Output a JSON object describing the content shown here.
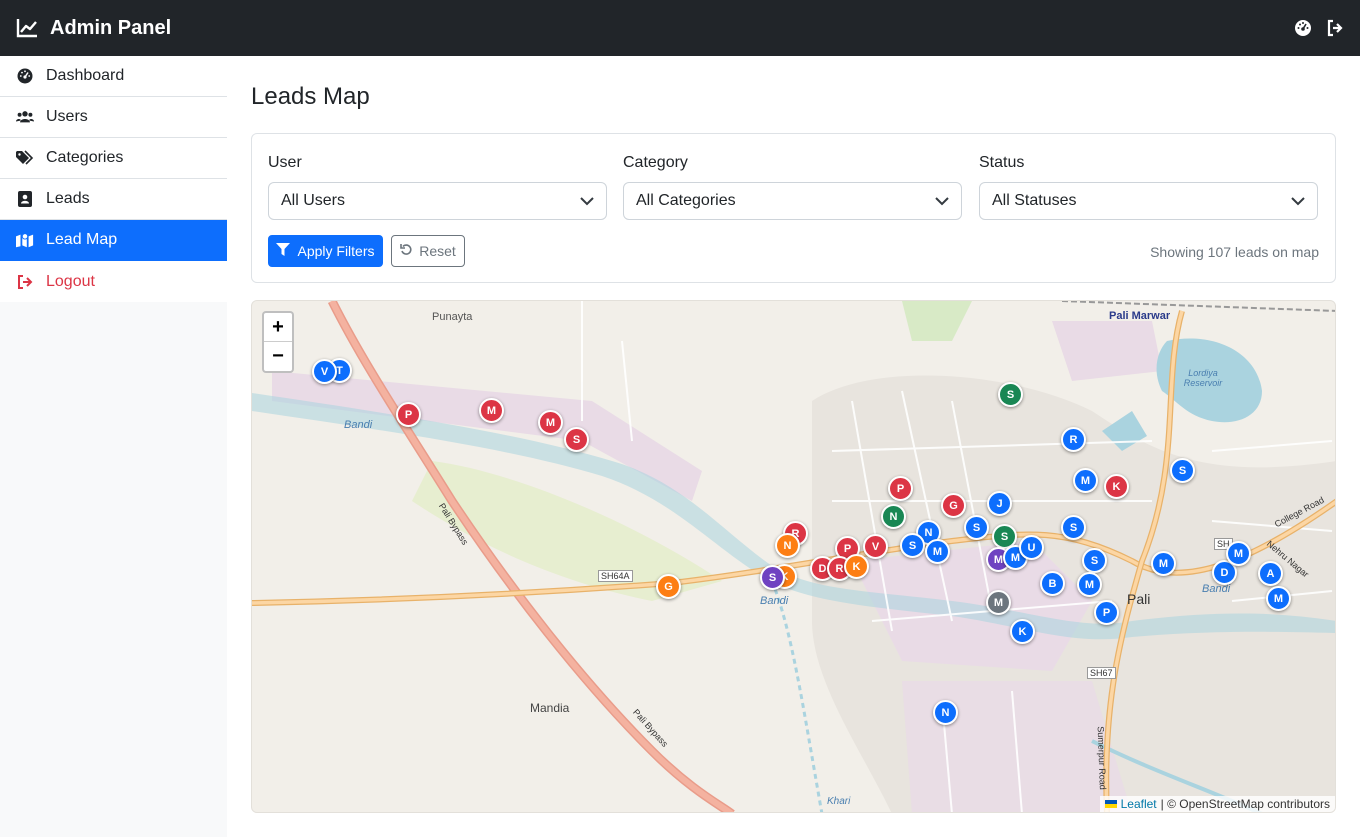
{
  "navbar": {
    "brand": "Admin Panel",
    "brand_icon": "chart-line-icon",
    "actions": [
      {
        "name": "dashboard-gauge-icon"
      },
      {
        "name": "logout-icon"
      }
    ]
  },
  "sidebar": {
    "items": [
      {
        "label": "Dashboard",
        "icon": "gauge-icon",
        "active": false
      },
      {
        "label": "Users",
        "icon": "users-icon",
        "active": false
      },
      {
        "label": "Categories",
        "icon": "tags-icon",
        "active": false
      },
      {
        "label": "Leads",
        "icon": "address-card-icon",
        "active": false
      },
      {
        "label": "Lead Map",
        "icon": "map-icon",
        "active": true
      },
      {
        "label": "Logout",
        "icon": "logout-icon",
        "active": false
      }
    ]
  },
  "page": {
    "title": "Leads Map"
  },
  "filters": {
    "user": {
      "label": "User",
      "value": "All Users"
    },
    "category": {
      "label": "Category",
      "value": "All Categories"
    },
    "status": {
      "label": "Status",
      "value": "All Statuses"
    },
    "apply_label": "Apply Filters",
    "reset_label": "Reset",
    "showing_text": "Showing 107 leads on map"
  },
  "map": {
    "zoom_in": "+",
    "zoom_out": "−",
    "attribution_link": "Leaflet",
    "attribution_text": "| © OpenStreetMap contributors",
    "place_labels": [
      "Punayta",
      "Pali Marwar",
      "Lordiya Reservoir",
      "Bandi",
      "Bandi",
      "Bandi",
      "Mandia",
      "Pali",
      "Pali Bypass",
      "Pali Bypass",
      "College Road",
      "Nehru Nagar",
      "Sumerpur Road",
      "Khari"
    ],
    "road_labels": [
      "SH64A",
      "SH67",
      "SH"
    ],
    "colors": {
      "blue": "#0d6efd",
      "red": "#dc3545",
      "green": "#198754",
      "orange": "#fd7e14",
      "purple": "#6f42c1",
      "gray": "#6c757d"
    },
    "markers": [
      {
        "letter": "T",
        "color": "blue"
      },
      {
        "letter": "V",
        "color": "blue"
      },
      {
        "letter": "P",
        "color": "red"
      },
      {
        "letter": "M",
        "color": "red"
      },
      {
        "letter": "M",
        "color": "red"
      },
      {
        "letter": "S",
        "color": "red"
      },
      {
        "letter": "S",
        "color": "green"
      },
      {
        "letter": "R",
        "color": "blue"
      },
      {
        "letter": "S",
        "color": "blue"
      },
      {
        "letter": "M",
        "color": "blue"
      },
      {
        "letter": "K",
        "color": "red"
      },
      {
        "letter": "P",
        "color": "red"
      },
      {
        "letter": "G",
        "color": "red"
      },
      {
        "letter": "J",
        "color": "blue"
      },
      {
        "letter": "N",
        "color": "green"
      },
      {
        "letter": "S",
        "color": "blue"
      },
      {
        "letter": "S",
        "color": "blue"
      },
      {
        "letter": "N",
        "color": "blue"
      },
      {
        "letter": "R",
        "color": "red"
      },
      {
        "letter": "N",
        "color": "orange"
      },
      {
        "letter": "P",
        "color": "red"
      },
      {
        "letter": "V",
        "color": "red"
      },
      {
        "letter": "S",
        "color": "blue"
      },
      {
        "letter": "M",
        "color": "blue"
      },
      {
        "letter": "S",
        "color": "green"
      },
      {
        "letter": "M",
        "color": "purple"
      },
      {
        "letter": "M",
        "color": "blue"
      },
      {
        "letter": "U",
        "color": "blue"
      },
      {
        "letter": "S",
        "color": "blue"
      },
      {
        "letter": "D",
        "color": "red"
      },
      {
        "letter": "R",
        "color": "red"
      },
      {
        "letter": "K",
        "color": "orange"
      },
      {
        "letter": "K",
        "color": "orange"
      },
      {
        "letter": "S",
        "color": "purple"
      },
      {
        "letter": "G",
        "color": "orange"
      },
      {
        "letter": "B",
        "color": "blue"
      },
      {
        "letter": "M",
        "color": "blue"
      },
      {
        "letter": "M",
        "color": "gray"
      },
      {
        "letter": "P",
        "color": "blue"
      },
      {
        "letter": "K",
        "color": "blue"
      },
      {
        "letter": "M",
        "color": "blue"
      },
      {
        "letter": "D",
        "color": "blue"
      },
      {
        "letter": "M",
        "color": "blue"
      },
      {
        "letter": "A",
        "color": "blue"
      },
      {
        "letter": "M",
        "color": "blue"
      },
      {
        "letter": "N",
        "color": "blue"
      }
    ]
  }
}
